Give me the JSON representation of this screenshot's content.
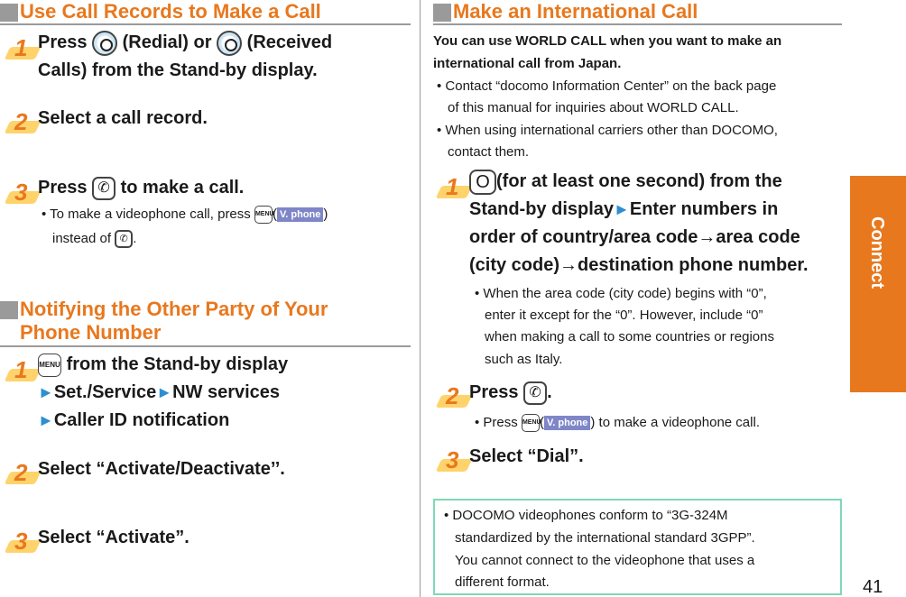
{
  "page_number": "41",
  "side_tab": {
    "label": "Connect",
    "color": "#e8781e"
  },
  "accent_color": "#e8781e",
  "left": {
    "section1": {
      "title": "Use Call Records to Make a Call",
      "steps": [
        {
          "num": "1",
          "before": "Press",
          "after": "(Redial) or",
          "after2": "(Received",
          "line2": "Calls) from the Stand-by display."
        },
        {
          "num": "2",
          "text": "Select a call record."
        },
        {
          "num": "3",
          "before": "Press",
          "after": "to make a call.",
          "note_before": "• To make a videophone call, press",
          "note_open": "(",
          "vphone": "V. phone",
          "note_close": ")",
          "note2_before": "instead of",
          "note2_after": "."
        }
      ]
    },
    "section2": {
      "title_line1": "Notifying the Other Party of Your",
      "title_line2": "Phone Number",
      "steps": [
        {
          "num": "1",
          "line1_after": "from the Stand-by display",
          "line2a": "Set./Service",
          "line2b": "NW services",
          "line3": "Caller ID notification"
        },
        {
          "num": "2",
          "text": "Select “Activate/Deactivate’’."
        },
        {
          "num": "3",
          "text": "Select “Activate”."
        }
      ]
    }
  },
  "right": {
    "section": {
      "title": "Make an International Call",
      "intro_line1": "You can use WORLD CALL when you want to make an",
      "intro_line2": "international call from Japan.",
      "bullets": [
        "• Contact “docomo Information Center” on the back page",
        "of this manual for inquiries about WORLD CALL.",
        "• When using international carriers other than DOCOMO,",
        "contact them."
      ],
      "step1": {
        "num": "1",
        "key": "O",
        "line1": "(for at least one second) from the",
        "line2a": "Stand-by display",
        "line2b": "Enter numbers in",
        "line3": "order of country/area code→area code",
        "line4": "(city code)→destination phone number.",
        "notes": [
          "• When the area code (city code) begins with “0”,",
          "enter it except for the “0”. However, include “0”",
          "when making a call to some countries or regions",
          "such as Italy."
        ]
      },
      "step2": {
        "num": "2",
        "before": "Press",
        "after": ".",
        "note_before": "• Press",
        "note_open": "(",
        "vphone": "V. phone",
        "note_after": ") to make a videophone call."
      },
      "step3": {
        "num": "3",
        "text": "Select “Dial”."
      }
    },
    "note_box": [
      "• DOCOMO videophones conform to “3G-324M",
      "standardized by the international standard 3GPP”.",
      "You cannot connect to the videophone that uses a",
      "different format."
    ]
  },
  "icons": {
    "menu_key": "MENU",
    "triangle": "►"
  }
}
